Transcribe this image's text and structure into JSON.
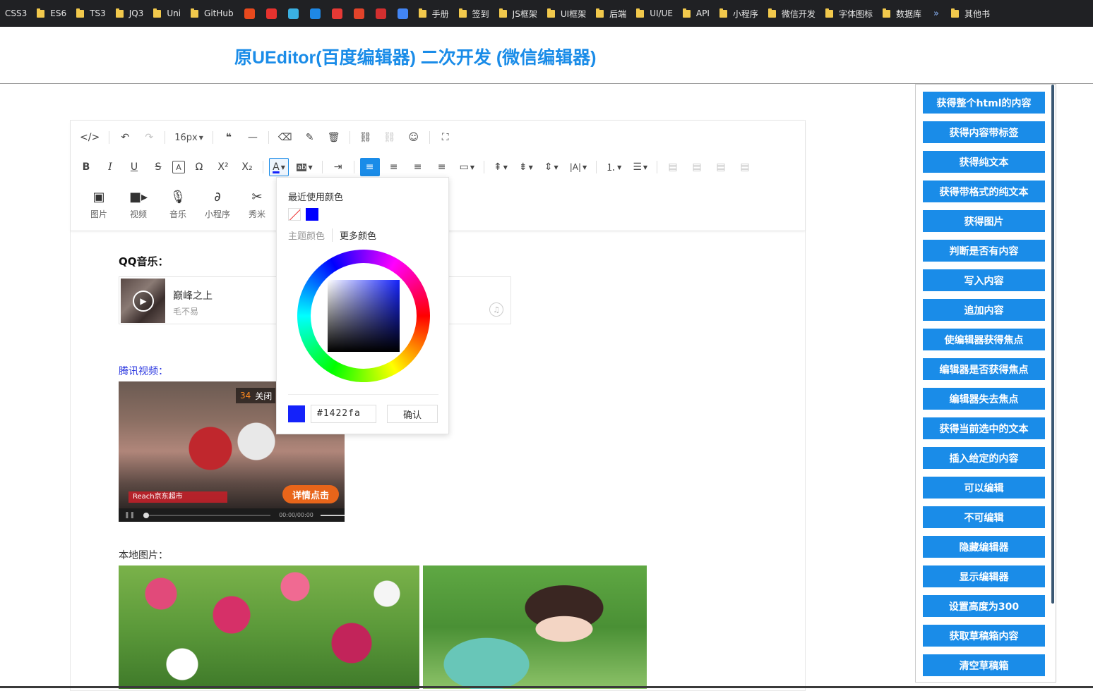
{
  "bookmarks": [
    {
      "label": "CSS3",
      "type": "text"
    },
    {
      "label": "ES6",
      "type": "folder"
    },
    {
      "label": "TS3",
      "type": "folder"
    },
    {
      "label": "JQ3",
      "type": "folder"
    },
    {
      "label": "Uni",
      "type": "folder"
    },
    {
      "label": "GitHub",
      "type": "folder"
    },
    {
      "label": "",
      "type": "favicon",
      "icon": "site-icon",
      "color": "#e8491d"
    },
    {
      "label": "",
      "type": "favicon",
      "icon": "flame-icon",
      "color": "#e6322e"
    },
    {
      "label": "",
      "type": "favicon",
      "icon": "diamond-icon",
      "color": "#3ab0e2"
    },
    {
      "label": "",
      "type": "favicon",
      "icon": "play-icon",
      "color": "#1e88e5"
    },
    {
      "label": "",
      "type": "favicon",
      "icon": "g-icon",
      "color": "#e53935"
    },
    {
      "label": "",
      "type": "favicon",
      "icon": "gitlab-icon",
      "color": "#e2432a"
    },
    {
      "label": "",
      "type": "favicon",
      "icon": "mask-icon",
      "color": "#d32f2f"
    },
    {
      "label": "",
      "type": "favicon",
      "icon": "translate-icon",
      "color": "#4285f4"
    },
    {
      "label": "手册",
      "type": "folder"
    },
    {
      "label": "签到",
      "type": "folder"
    },
    {
      "label": "JS框架",
      "type": "folder"
    },
    {
      "label": "UI框架",
      "type": "folder"
    },
    {
      "label": "后端",
      "type": "folder"
    },
    {
      "label": "UI/UE",
      "type": "folder"
    },
    {
      "label": "API",
      "type": "folder"
    },
    {
      "label": "小程序",
      "type": "folder"
    },
    {
      "label": "微信开发",
      "type": "folder"
    },
    {
      "label": "字体图标",
      "type": "folder"
    },
    {
      "label": "数据库",
      "type": "folder"
    }
  ],
  "bookmarks_more": "»",
  "bookmarks_other": "其他书",
  "page": {
    "title": "原UEditor(百度编辑器) 二次开发 (微信编辑器)"
  },
  "toolbar": {
    "font_size": "16px",
    "media": [
      {
        "label": "图片",
        "icon": "image-icon"
      },
      {
        "label": "视频",
        "icon": "video-icon"
      },
      {
        "label": "音乐",
        "icon": "mic-icon"
      },
      {
        "label": "小程序",
        "icon": "link-icon"
      },
      {
        "label": "秀米",
        "icon": "xiumi-icon"
      }
    ]
  },
  "content": {
    "qq_label": "QQ音乐：",
    "song_title": "巅峰之上",
    "song_artist": "毛不易",
    "video_label": "腾讯视频：",
    "video_countdown": "34",
    "video_close": "关闭",
    "video_ad_text": "Reach京东超市",
    "video_cta": "详情点击",
    "video_time": "00:00/00:00",
    "image_label": "本地图片："
  },
  "color_picker": {
    "recent_label": "最近使用颜色",
    "recent_colors": [
      "none",
      "#0000ff"
    ],
    "tab_theme": "主题颜色",
    "tab_more": "更多颜色",
    "hex_value": "#1422fa",
    "confirm_label": "确认",
    "current_color": "#1422fa"
  },
  "sidebar": {
    "buttons": [
      "获得整个html的内容",
      "获得内容带标签",
      "获得纯文本",
      "获得带格式的纯文本",
      "获得图片",
      "判断是否有内容",
      "写入内容",
      "追加内容",
      "使编辑器获得焦点",
      "编辑器是否获得焦点",
      "编辑器失去焦点",
      "获得当前选中的文本",
      "插入给定的内容",
      "可以编辑",
      "不可编辑",
      "隐藏编辑器",
      "显示编辑器",
      "设置高度为300",
      "获取草稿箱内容",
      "清空草稿箱"
    ]
  },
  "colors": {
    "accent": "#1a8ce8",
    "title": "#1a8ce8",
    "video_link": "#2b37e0"
  }
}
